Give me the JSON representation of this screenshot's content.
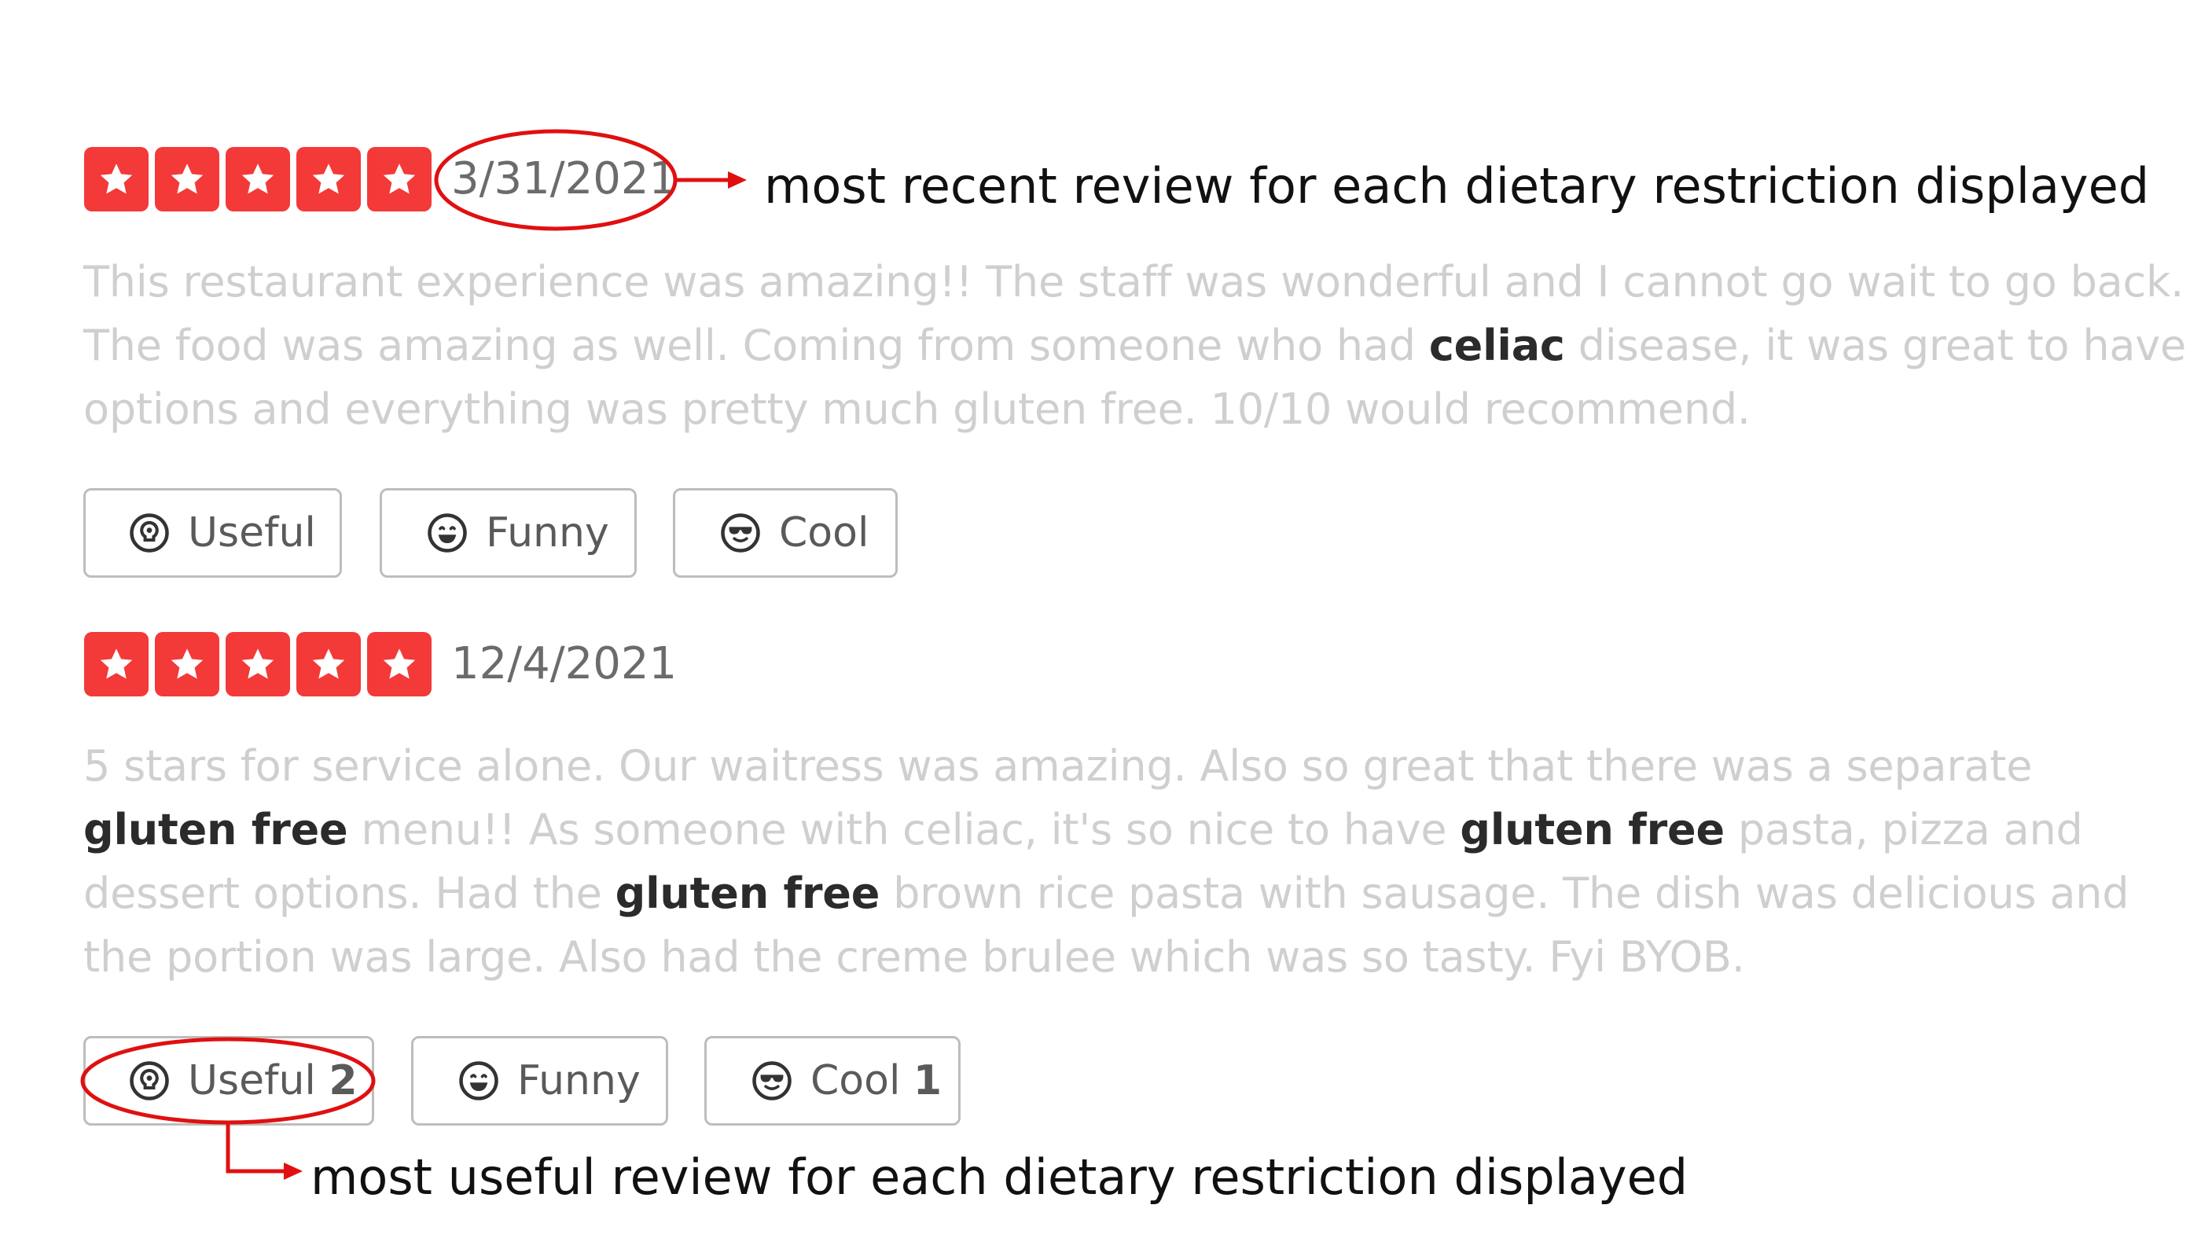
{
  "reviews": [
    {
      "rating": 5,
      "date": "3/31/2021",
      "text": [
        {
          "t": "This restaurant experience was amazing!! The staff was wonderful and I cannot go wait to go back. The food was amazing as well. Coming from someone who had ",
          "b": false
        },
        {
          "t": "celiac",
          "b": true
        },
        {
          "t": " disease, it was great to have options and everything was pretty much gluten free. 10/10 would recommend.",
          "b": false
        }
      ],
      "buttons": {
        "useful": {
          "label": "Useful",
          "count": ""
        },
        "funny": {
          "label": "Funny",
          "count": ""
        },
        "cool": {
          "label": "Cool",
          "count": ""
        }
      }
    },
    {
      "rating": 5,
      "date": "12/4/2021",
      "text": [
        {
          "t": "5 stars for service alone.  Our waitress was amazing.  Also so great that there was a separate ",
          "b": false
        },
        {
          "t": "gluten free",
          "b": true
        },
        {
          "t": " menu!!  As someone with celiac, it's so nice to have ",
          "b": false
        },
        {
          "t": "gluten free",
          "b": true
        },
        {
          "t": " pasta, pizza and dessert options.  Had the ",
          "b": false
        },
        {
          "t": "gluten free",
          "b": true
        },
        {
          "t": " brown rice pasta with sausage. The dish was delicious and the portion was large.  Also had the creme brulee which was so tasty.  Fyi BYOB.",
          "b": false
        }
      ],
      "buttons": {
        "useful": {
          "label": "Useful",
          "count": "2"
        },
        "funny": {
          "label": "Funny",
          "count": ""
        },
        "cool": {
          "label": "Cool",
          "count": "1"
        }
      }
    }
  ],
  "annotations": {
    "recent": "most recent review for each dietary restriction displayed",
    "useful": "most useful review for each dietary restriction displayed"
  },
  "colors": {
    "star_bg": "#f43939",
    "annotation_red": "#e01010",
    "review_text": "#cfcfcf",
    "highlight_text": "#2b2b2b"
  },
  "icons": [
    "star-icon",
    "lightbulb-icon",
    "grin-face-icon",
    "sunglasses-face-icon"
  ]
}
